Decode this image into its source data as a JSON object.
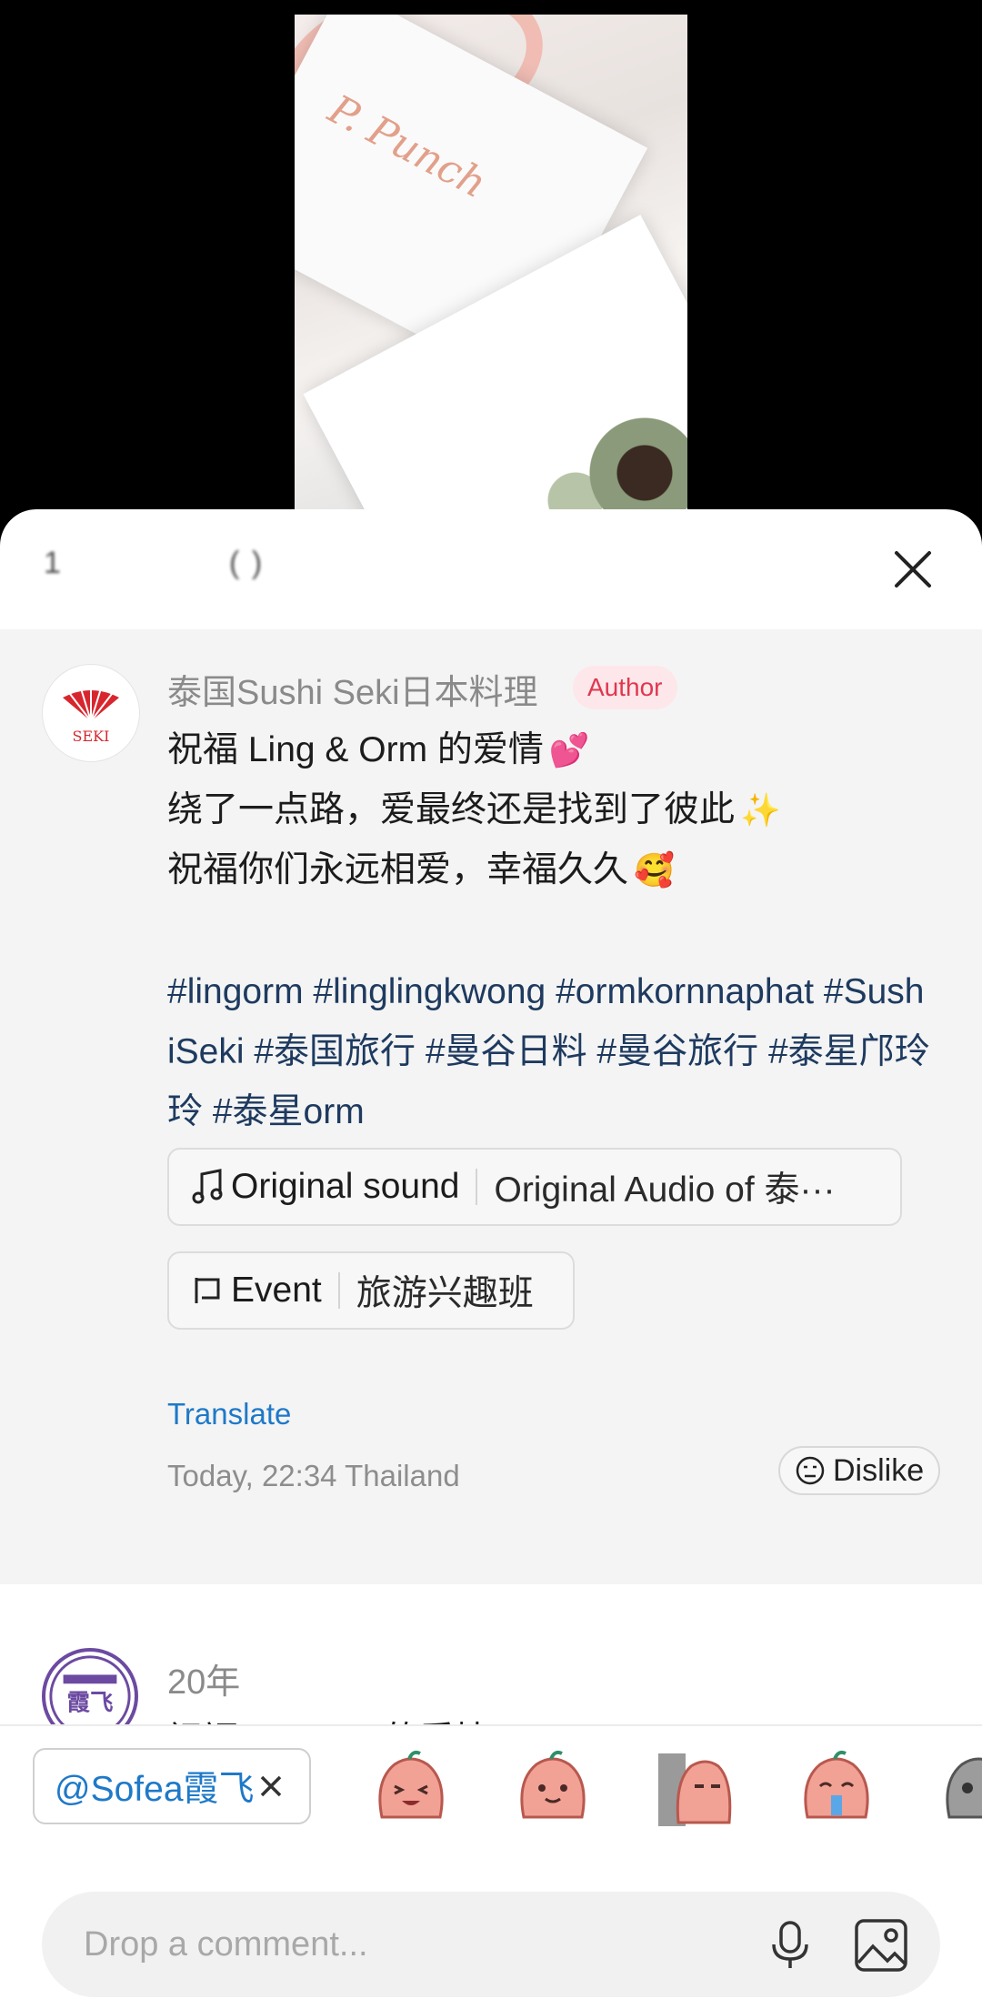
{
  "sheet": {
    "title": "1                ( )"
  },
  "video": {
    "card_text": "P. Punch"
  },
  "comment": {
    "username": "泰国Sushi Seki日本料理",
    "author_label": "Author",
    "avatar_logo_text": "SEKI",
    "lines": [
      {
        "text": "祝福 Ling & Orm 的爱情",
        "emoji": "💕"
      },
      {
        "text": "绕了一点路，爱最终还是找到了彼此",
        "emoji": "✨"
      },
      {
        "text": "祝福你们永远相爱，幸福久久",
        "emoji": "🥰"
      }
    ],
    "hashtags": "#lingorm #linglingkwong #ormkornnaphat #SushiSeki #泰国旅行  #曼谷日料 #曼谷旅行 #泰星邝玲玲 #泰星orm",
    "sound_label": "Original sound",
    "sound_value": "Original Audio of 泰···",
    "event_label": "Event",
    "event_value": "旅游兴趣班",
    "translate": "Translate",
    "timestamp": "Today, 22:34 Thailand",
    "dislike": "Dislike"
  },
  "reply": {
    "username": "20年",
    "text_partial": "祝福Ling Orm的爱情",
    "avatar_text": "霞飞"
  },
  "bottom": {
    "mention": "@Sofea霞飞",
    "input_placeholder": "Drop a comment...",
    "stickers": [
      "laughing-sticker",
      "smiling-sticker",
      "peeking-sticker",
      "crying-sticker",
      "gray-sticker"
    ]
  },
  "colors": {
    "accent_blue": "#1e79c8",
    "hashtag": "#1e3a5f",
    "author_red": "#e0374f"
  }
}
